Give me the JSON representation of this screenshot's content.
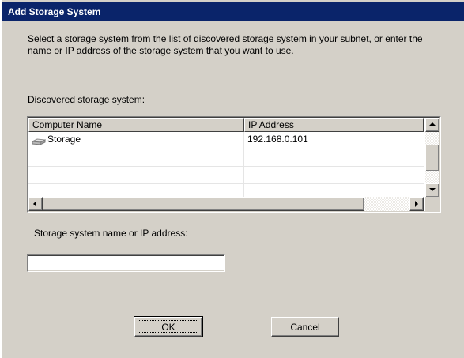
{
  "window": {
    "title": "Add Storage System"
  },
  "description": "Select a storage system from the list of discovered storage system in your subnet, or enter the name or IP address of the storage system that you want to use.",
  "discovered_label": "Discovered storage system:",
  "list": {
    "columns": [
      "Computer Name",
      "IP Address"
    ],
    "rows": [
      {
        "name": "Storage",
        "ip": "192.168.0.101",
        "icon": "drive-icon"
      },
      {
        "name": "",
        "ip": ""
      },
      {
        "name": "",
        "ip": ""
      },
      {
        "name": "",
        "ip": ""
      }
    ]
  },
  "name_field": {
    "label": "Storage system name or IP address:",
    "value": "",
    "placeholder": ""
  },
  "buttons": {
    "ok": "OK",
    "cancel": "Cancel"
  },
  "colors": {
    "titlebar": "#0a246a",
    "face": "#d4d0c8"
  }
}
